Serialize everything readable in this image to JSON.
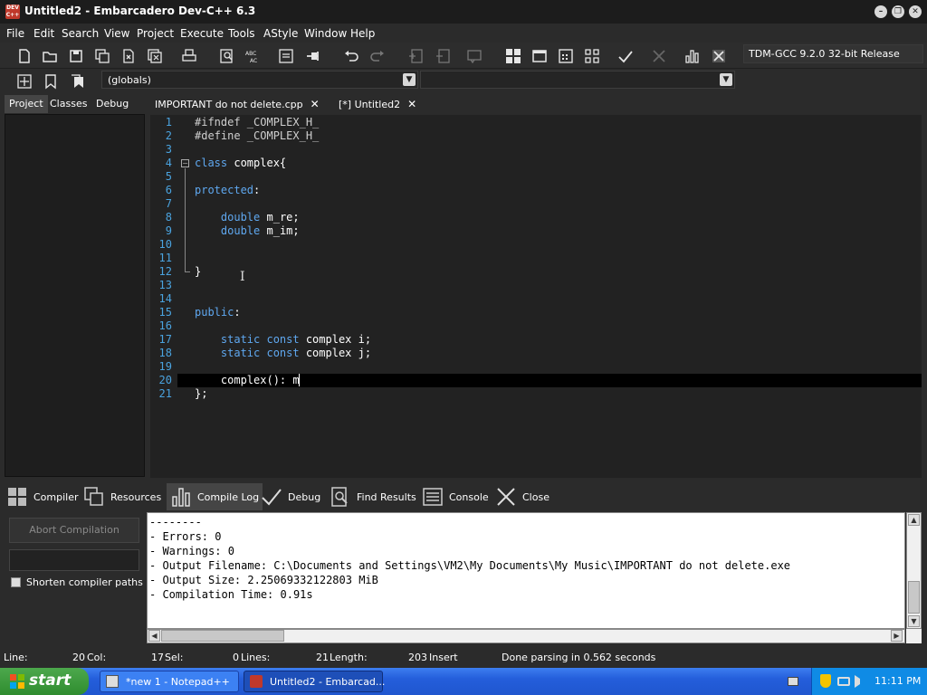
{
  "window": {
    "title": "Untitled2 - Embarcadero Dev-C++ 6.3",
    "app_icon_text": "DEV C++"
  },
  "menu": [
    "File",
    "Edit",
    "Search",
    "View",
    "Project",
    "Execute",
    "Tools",
    "AStyle",
    "Window",
    "Help"
  ],
  "toolbar": {
    "compiler": "TDM-GCC 9.2.0 32-bit Release",
    "globals": "(globals)",
    "icon_labels": {
      "abc": "ABC",
      "abc2": "AC"
    }
  },
  "project_tabs": [
    "Project",
    "Classes",
    "Debug"
  ],
  "editor_tabs": [
    {
      "label": "IMPORTANT do not delete.cpp"
    },
    {
      "label": "[*] Untitled2",
      "active": true
    }
  ],
  "editor": {
    "lines": [
      {
        "n": "1",
        "t": [
          {
            "c": "pp",
            "s": "#ifndef _COMPLEX_H_"
          }
        ]
      },
      {
        "n": "2",
        "t": [
          {
            "c": "pp",
            "s": "#define _COMPLEX_H_"
          }
        ]
      },
      {
        "n": "3",
        "t": []
      },
      {
        "n": "4",
        "t": [
          {
            "c": "kw",
            "s": "class"
          },
          {
            "c": "",
            "s": " complex{"
          }
        ]
      },
      {
        "n": "5",
        "t": []
      },
      {
        "n": "6",
        "t": [
          {
            "c": "kw",
            "s": "protected"
          },
          {
            "c": "",
            "s": ":"
          }
        ]
      },
      {
        "n": "7",
        "t": []
      },
      {
        "n": "8",
        "t": [
          {
            "c": "",
            "s": "    "
          },
          {
            "c": "kw",
            "s": "double"
          },
          {
            "c": "",
            "s": " m_re;"
          }
        ]
      },
      {
        "n": "9",
        "t": [
          {
            "c": "",
            "s": "    "
          },
          {
            "c": "kw",
            "s": "double"
          },
          {
            "c": "",
            "s": " m_im;"
          }
        ]
      },
      {
        "n": "10",
        "t": []
      },
      {
        "n": "11",
        "t": []
      },
      {
        "n": "12",
        "t": [
          {
            "c": "",
            "s": "}"
          }
        ]
      },
      {
        "n": "13",
        "t": []
      },
      {
        "n": "14",
        "t": []
      },
      {
        "n": "15",
        "t": [
          {
            "c": "kw",
            "s": "public"
          },
          {
            "c": "",
            "s": ":"
          }
        ]
      },
      {
        "n": "16",
        "t": []
      },
      {
        "n": "17",
        "t": [
          {
            "c": "",
            "s": "    "
          },
          {
            "c": "kw",
            "s": "static const"
          },
          {
            "c": "",
            "s": " complex i;"
          }
        ]
      },
      {
        "n": "18",
        "t": [
          {
            "c": "",
            "s": "    "
          },
          {
            "c": "kw",
            "s": "static const"
          },
          {
            "c": "",
            "s": " complex j;"
          }
        ]
      },
      {
        "n": "19",
        "t": []
      },
      {
        "n": "20",
        "t": [
          {
            "c": "",
            "s": "    complex(): m"
          }
        ],
        "current": true
      },
      {
        "n": "21",
        "t": [
          {
            "c": "",
            "s": "};"
          }
        ]
      }
    ],
    "fold_marker": "−"
  },
  "bottom_tabs": [
    {
      "label": "Compiler",
      "icon": "grid-icon"
    },
    {
      "label": "Resources",
      "icon": "copy-icon"
    },
    {
      "label": "Compile Log",
      "icon": "bar-chart-icon",
      "active": true
    },
    {
      "label": "Debug",
      "icon": "check-icon"
    },
    {
      "label": "Find Results",
      "icon": "search-doc-icon"
    },
    {
      "label": "Console",
      "icon": "console-icon"
    },
    {
      "label": "Close",
      "icon": "close-icon"
    }
  ],
  "compile_panel": {
    "abort_label": "Abort Compilation",
    "shorten_label": "Shorten compiler paths"
  },
  "compile_log": [
    "--------",
    "- Errors: 0",
    "- Warnings: 0",
    "- Output Filename: C:\\Documents and Settings\\VM2\\My Documents\\My Music\\IMPORTANT do not delete.exe",
    "- Output Size: 2.25069332122803 MiB",
    "- Compilation Time: 0.91s"
  ],
  "status": {
    "line_label": "Line:",
    "line_value": "20",
    "col_label": "Col:",
    "col_value": "17",
    "sel_label": "Sel:",
    "sel_value": "0",
    "lines_label": "Lines:",
    "lines_value": "21",
    "length_label": "Length:",
    "length_value": "203",
    "mode": "Insert",
    "message": "Done parsing in 0.562 seconds"
  },
  "taskbar": {
    "start": "start",
    "tasks": [
      {
        "label": "*new 1 - Notepad++"
      },
      {
        "label": "Untitled2 - Embarcad...",
        "active": true
      }
    ],
    "clock": "11:11 PM"
  },
  "colors": {
    "keyword": "#5fa8f0",
    "line_number": "#4aa3df",
    "background": "#222222",
    "taskbar": "#245edb"
  }
}
